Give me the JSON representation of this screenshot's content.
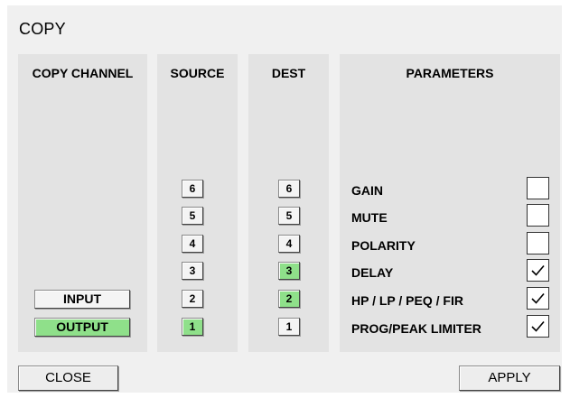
{
  "dialog": {
    "title": "COPY"
  },
  "panels": {
    "copy_channel": {
      "header": "COPY CHANNEL"
    },
    "source": {
      "header": "SOURCE"
    },
    "dest": {
      "header": "DEST"
    },
    "parameters": {
      "header": "PARAMETERS"
    }
  },
  "copy_channel_buttons": [
    {
      "label": "INPUT",
      "selected": false
    },
    {
      "label": "OUTPUT",
      "selected": true
    }
  ],
  "source_channels": [
    {
      "label": "6",
      "selected": false
    },
    {
      "label": "5",
      "selected": false
    },
    {
      "label": "4",
      "selected": false
    },
    {
      "label": "3",
      "selected": false
    },
    {
      "label": "2",
      "selected": false
    },
    {
      "label": "1",
      "selected": true
    }
  ],
  "dest_channels": [
    {
      "label": "6",
      "selected": false
    },
    {
      "label": "5",
      "selected": false
    },
    {
      "label": "4",
      "selected": false
    },
    {
      "label": "3",
      "selected": true
    },
    {
      "label": "2",
      "selected": true
    },
    {
      "label": "1",
      "selected": false
    }
  ],
  "parameters": [
    {
      "label": "GAIN",
      "checked": false
    },
    {
      "label": "MUTE",
      "checked": false
    },
    {
      "label": "POLARITY",
      "checked": false
    },
    {
      "label": "DELAY",
      "checked": true
    },
    {
      "label": "HP / LP / PEQ / FIR",
      "checked": true
    },
    {
      "label": "PROG/PEAK LIMITER",
      "checked": true
    }
  ],
  "footer": {
    "close_label": "CLOSE",
    "apply_label": "APPLY"
  },
  "colors": {
    "dialog_bg": "#f0f0f0",
    "panel_bg": "#e3e3e3",
    "selected_green": "#8fe08a"
  }
}
